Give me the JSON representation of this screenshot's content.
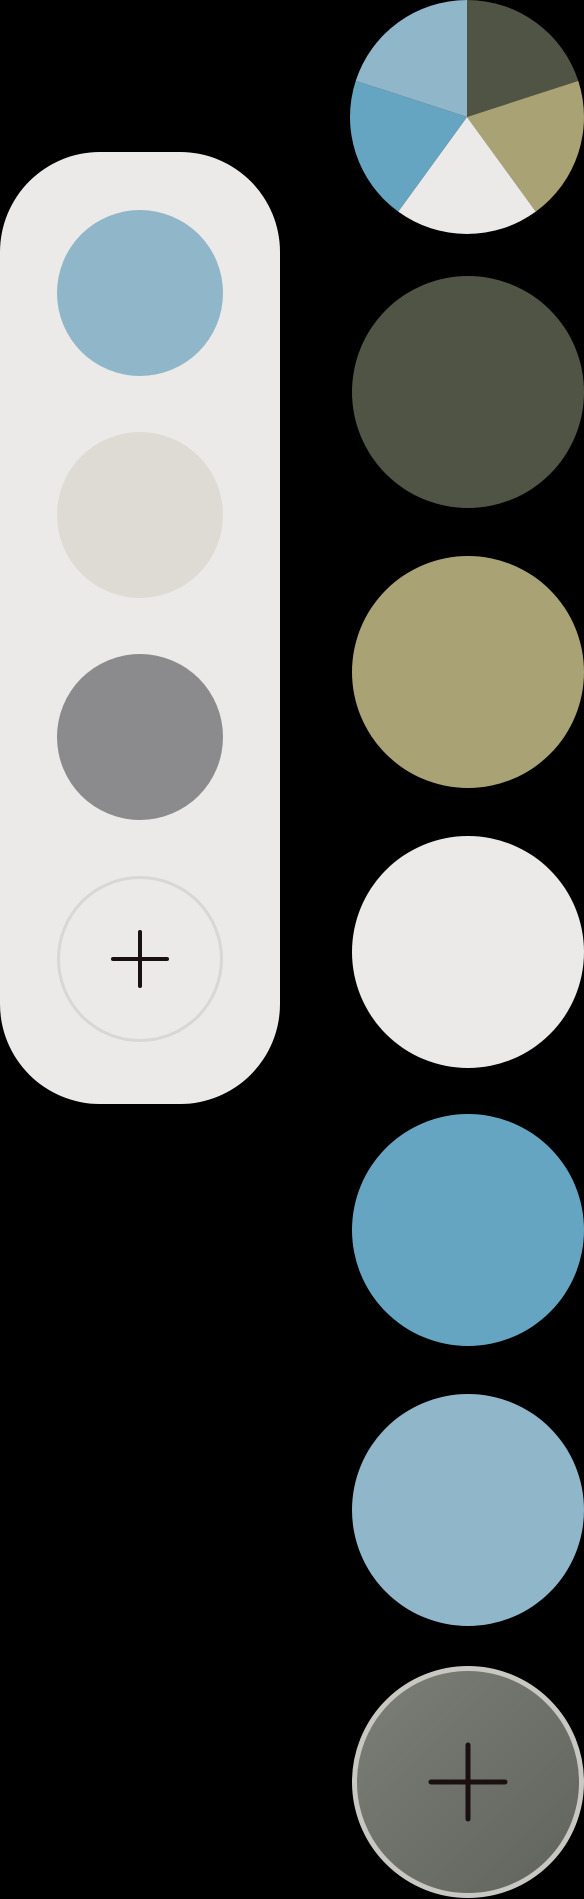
{
  "palette_panel": {
    "swatches": [
      {
        "color": "#8fb6c9",
        "icon": "color-swatch"
      },
      {
        "color": "#dddbd4",
        "icon": "color-swatch"
      },
      {
        "color": "#8b8a8c",
        "icon": "color-swatch"
      }
    ],
    "add_swatch": {
      "icon": "plus-icon",
      "border_color": "#d9d7d3",
      "glyph_color": "#1a1012"
    }
  },
  "color_wheel": {
    "icon": "pie-palette",
    "slices": [
      {
        "color": "#505445",
        "share": 0.2
      },
      {
        "color": "#a9a274",
        "share": 0.2
      },
      {
        "color": "#ebeae8",
        "share": 0.2
      },
      {
        "color": "#66a5c2",
        "share": 0.2
      },
      {
        "color": "#8fb6c9",
        "share": 0.2
      }
    ]
  },
  "swatch_column": [
    {
      "color": "#505445"
    },
    {
      "color": "#a9a274"
    },
    {
      "color": "#ebeae8"
    },
    {
      "color": "#66a5c2"
    },
    {
      "color": "#8fb6c9"
    }
  ],
  "add_color_button": {
    "icon": "plus-icon",
    "gradient": [
      "#7c7e78",
      "#60645c"
    ],
    "glyph_color": "#1a1012"
  }
}
